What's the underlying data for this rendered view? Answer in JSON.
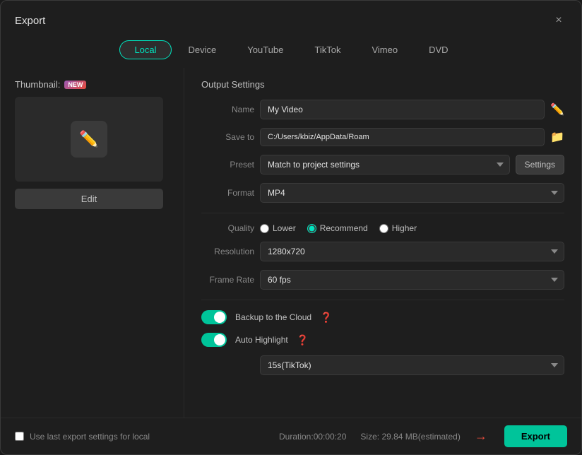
{
  "dialog": {
    "title": "Export",
    "close_label": "×"
  },
  "tabs": [
    {
      "id": "local",
      "label": "Local",
      "active": true
    },
    {
      "id": "device",
      "label": "Device",
      "active": false
    },
    {
      "id": "youtube",
      "label": "YouTube",
      "active": false
    },
    {
      "id": "tiktok",
      "label": "TikTok",
      "active": false
    },
    {
      "id": "vimeo",
      "label": "Vimeo",
      "active": false
    },
    {
      "id": "dvd",
      "label": "DVD",
      "active": false
    }
  ],
  "left_panel": {
    "thumbnail_label": "Thumbnail:",
    "new_badge": "NEW",
    "edit_button": "Edit"
  },
  "output_settings": {
    "section_title": "Output Settings",
    "name_label": "Name",
    "name_value": "My Video",
    "save_to_label": "Save to",
    "save_path": "C:/Users/kbiz/AppData/Roam",
    "preset_label": "Preset",
    "preset_value": "Match to project settings",
    "settings_button": "Settings",
    "format_label": "Format",
    "format_value": "MP4",
    "quality_label": "Quality",
    "quality_options": [
      {
        "id": "lower",
        "label": "Lower",
        "selected": false
      },
      {
        "id": "recommend",
        "label": "Recommend",
        "selected": true
      },
      {
        "id": "higher",
        "label": "Higher",
        "selected": false
      }
    ],
    "resolution_label": "Resolution",
    "resolution_value": "1280x720",
    "frame_rate_label": "Frame Rate",
    "frame_rate_value": "60 fps",
    "backup_cloud_label": "Backup to the Cloud",
    "backup_cloud_on": true,
    "auto_highlight_label": "Auto Highlight",
    "auto_highlight_on": true,
    "tiktok_duration": "15s(TikTok)"
  },
  "footer": {
    "last_export_label": "Use last export settings for local",
    "duration_label": "Duration:",
    "duration_value": "00:00:20",
    "size_label": "Size:",
    "size_value": "29.84 MB(estimated)",
    "export_button": "Export"
  }
}
